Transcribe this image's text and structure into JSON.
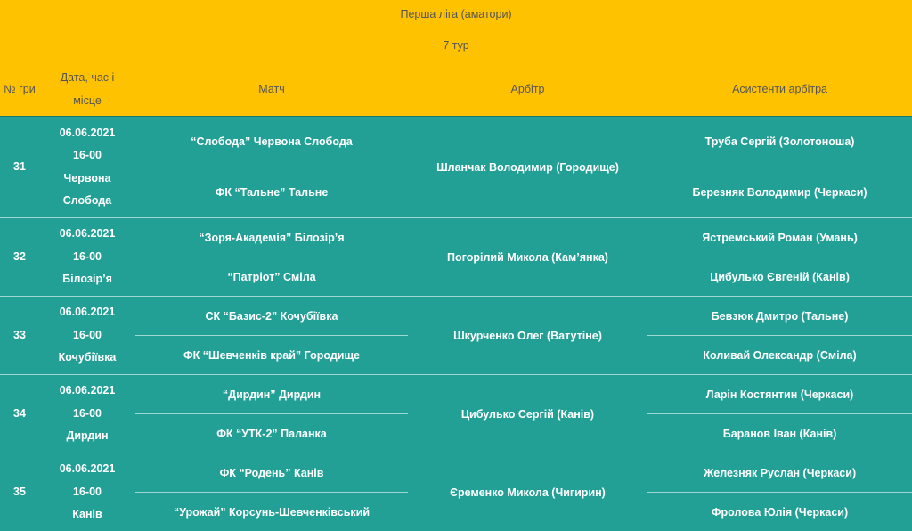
{
  "league": "Перша ліга (аматори)",
  "round": "7 тур",
  "headers": {
    "num": "№ гри",
    "date": "Дата, час і місце",
    "match": "Матч",
    "referee": "Арбітр",
    "assistants": "Асистенти арбітра"
  },
  "games": [
    {
      "num": "31",
      "date": "06.06.2021",
      "time": "16-00",
      "place": "Червона Слобода",
      "home": "“Слобода” Червона Слобода",
      "away": "ФК “Тальне” Тальне",
      "referee": "Шланчак Володимир (Городище)",
      "assistant1": "Труба Сергій (Золотоноша)",
      "assistant2": "Березняк Володимир (Черкаси)"
    },
    {
      "num": "32",
      "date": "06.06.2021",
      "time": "16-00",
      "place": "Білозір’я",
      "home": "“Зоря-Академія” Білозір’я",
      "away": "“Патріот” Сміла",
      "referee": "Погорілий Микола (Кам’янка)",
      "assistant1": "Ястремський Роман (Умань)",
      "assistant2": "Цибулько Євгеній (Канів)"
    },
    {
      "num": "33",
      "date": "06.06.2021",
      "time": "16-00",
      "place": "Кочубіївка",
      "home": "СК “Базис-2” Кочубіївка",
      "away": "ФК “Шевченків край” Городище",
      "referee": "Шкурченко Олег (Ватутіне)",
      "assistant1": "Бевзюк Дмитро (Тальне)",
      "assistant2": "Коливай Олександр (Сміла)"
    },
    {
      "num": "34",
      "date": "06.06.2021",
      "time": "16-00",
      "place": "Дирдин",
      "home": "“Дирдин” Дирдин",
      "away": "ФК “УТК-2” Паланка",
      "referee": "Цибулько Сергій (Канів)",
      "assistant1": "Ларін Костянтин (Черкаси)",
      "assistant2": "Баранов Іван (Канів)"
    },
    {
      "num": "35",
      "date": "06.06.2021",
      "time": "16-00",
      "place": "Канів",
      "home": "ФК “Родень” Канів",
      "away": "“Урожай” Корсунь-Шевченківський",
      "referee": "Єременко Микола (Чигирин)",
      "assistant1": "Железняк Руслан (Черкаси)",
      "assistant2": "Фролова Юлія (Черкаси)"
    }
  ]
}
